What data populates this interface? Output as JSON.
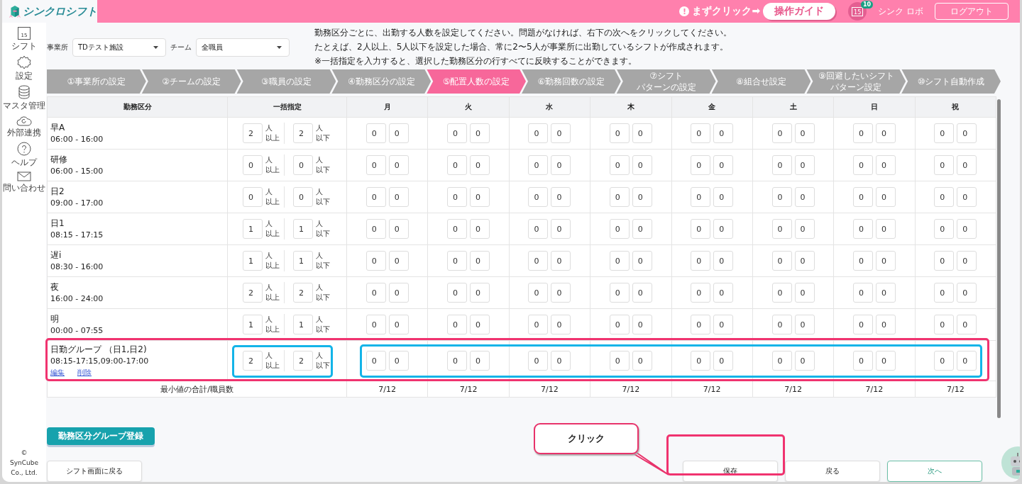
{
  "header": {
    "app_name": "シンクロシフト",
    "hint_icon": "!",
    "hint": "まずクリック➡",
    "guide_button": "操作ガイド",
    "calendar_day": "15",
    "notification_count": "10",
    "user": "シンク ロボ",
    "logout": "ログアウト"
  },
  "sidebar": {
    "items": [
      {
        "label": "シフト",
        "icon_text": "15"
      },
      {
        "label": "設定"
      },
      {
        "label": "マスタ管理"
      },
      {
        "label": "外部連携"
      },
      {
        "label": "ヘルプ"
      },
      {
        "label": "問い合わせ"
      }
    ],
    "copyright": "© SynCube Co., Ltd."
  },
  "filters": [
    {
      "label": "事業所",
      "value": "TDテスト施設"
    },
    {
      "label": "チーム",
      "value": "全職員"
    }
  ],
  "instructions": [
    "勤務区分ごとに、出勤する人数を設定してください。問題がなければ、右下の次へをクリックしてください。",
    "たとえば、2人以上、5人以下を設定した場合、常に2〜5人が事業所に出勤しているシフトが作成されます。",
    "※一括指定を入力すると、選択した勤務区分の行すべてに反映することができます。"
  ],
  "steps": [
    {
      "lines": [
        "①事業所の設定"
      ],
      "selected": false
    },
    {
      "lines": [
        "②チームの設定"
      ],
      "selected": false
    },
    {
      "lines": [
        "③職員の設定"
      ],
      "selected": false
    },
    {
      "lines": [
        "④勤務区分の設定"
      ],
      "selected": false
    },
    {
      "lines": [
        "⑤配置人数の設定"
      ],
      "selected": true
    },
    {
      "lines": [
        "⑥勤務回数の設定"
      ],
      "selected": false
    },
    {
      "lines": [
        "⑦シフト",
        "パターンの設定"
      ],
      "selected": false
    },
    {
      "lines": [
        "⑧組合せ設定"
      ],
      "selected": false
    },
    {
      "lines": [
        "⑨回避したいシフト",
        "パターン設定"
      ],
      "selected": false
    },
    {
      "lines": [
        "⑩シフト自動作成"
      ],
      "selected": false
    }
  ],
  "table": {
    "columns": [
      "勤務区分",
      "一括指定",
      "月",
      "火",
      "水",
      "木",
      "金",
      "土",
      "日",
      "祝"
    ],
    "rows": [
      {
        "kind": "shift",
        "name": "早A",
        "time": "06:00 - 16:00",
        "min": "2",
        "min_unit": [
          "人",
          "以上"
        ],
        "max": "2",
        "max_unit": [
          "人",
          "以下"
        ],
        "days": [
          [
            "0",
            "0"
          ],
          [
            "0",
            "0"
          ],
          [
            "0",
            "0"
          ],
          [
            "0",
            "0"
          ],
          [
            "0",
            "0"
          ],
          [
            "0",
            "0"
          ],
          [
            "0",
            "0"
          ],
          [
            "0",
            "0"
          ]
        ]
      },
      {
        "kind": "shift",
        "name": "研修",
        "time": "06:00 - 15:00",
        "min": "0",
        "min_unit": [
          "人",
          "以上"
        ],
        "max": "0",
        "max_unit": [
          "人",
          "以下"
        ],
        "days": [
          [
            "0",
            "0"
          ],
          [
            "0",
            "0"
          ],
          [
            "0",
            "0"
          ],
          [
            "0",
            "0"
          ],
          [
            "0",
            "0"
          ],
          [
            "0",
            "0"
          ],
          [
            "0",
            "0"
          ],
          [
            "0",
            "0"
          ]
        ]
      },
      {
        "kind": "shift",
        "name": "日2",
        "time": "09:00 - 17:00",
        "min": "0",
        "min_unit": [
          "人",
          "以上"
        ],
        "max": "0",
        "max_unit": [
          "人",
          "以下"
        ],
        "days": [
          [
            "0",
            "0"
          ],
          [
            "0",
            "0"
          ],
          [
            "0",
            "0"
          ],
          [
            "0",
            "0"
          ],
          [
            "0",
            "0"
          ],
          [
            "0",
            "0"
          ],
          [
            "0",
            "0"
          ],
          [
            "0",
            "0"
          ]
        ]
      },
      {
        "kind": "shift",
        "name": "日1",
        "time": "08:15 - 17:15",
        "min": "1",
        "min_unit": [
          "人",
          "以上"
        ],
        "max": "1",
        "max_unit": [
          "人",
          "以下"
        ],
        "days": [
          [
            "0",
            "0"
          ],
          [
            "0",
            "0"
          ],
          [
            "0",
            "0"
          ],
          [
            "0",
            "0"
          ],
          [
            "0",
            "0"
          ],
          [
            "0",
            "0"
          ],
          [
            "0",
            "0"
          ],
          [
            "0",
            "0"
          ]
        ]
      },
      {
        "kind": "shift",
        "name": "遅i",
        "time": "08:30 - 16:00",
        "min": "1",
        "min_unit": [
          "人",
          "以上"
        ],
        "max": "1",
        "max_unit": [
          "人",
          "以下"
        ],
        "days": [
          [
            "0",
            "0"
          ],
          [
            "0",
            "0"
          ],
          [
            "0",
            "0"
          ],
          [
            "0",
            "0"
          ],
          [
            "0",
            "0"
          ],
          [
            "0",
            "0"
          ],
          [
            "0",
            "0"
          ],
          [
            "0",
            "0"
          ]
        ]
      },
      {
        "kind": "shift",
        "name": "夜",
        "time": "16:00 - 24:00",
        "min": "2",
        "min_unit": [
          "人",
          "以上"
        ],
        "max": "2",
        "max_unit": [
          "人",
          "以下"
        ],
        "days": [
          [
            "0",
            "0"
          ],
          [
            "0",
            "0"
          ],
          [
            "0",
            "0"
          ],
          [
            "0",
            "0"
          ],
          [
            "0",
            "0"
          ],
          [
            "0",
            "0"
          ],
          [
            "0",
            "0"
          ],
          [
            "0",
            "0"
          ]
        ]
      },
      {
        "kind": "shift",
        "name": "明",
        "time": "00:00 - 07:55",
        "min": "1",
        "min_unit": [
          "人",
          "以上"
        ],
        "max": "1",
        "max_unit": [
          "人",
          "以下"
        ],
        "days": [
          [
            "0",
            "0"
          ],
          [
            "0",
            "0"
          ],
          [
            "0",
            "0"
          ],
          [
            "0",
            "0"
          ],
          [
            "0",
            "0"
          ],
          [
            "0",
            "0"
          ],
          [
            "0",
            "0"
          ],
          [
            "0",
            "0"
          ]
        ]
      },
      {
        "kind": "group",
        "name": "日勤グループ （日1,日2)",
        "time": "08:15-17:15,09:00-17:00",
        "links": [
          "編集",
          "削除"
        ],
        "min": "2",
        "min_unit": [
          "人",
          "以上"
        ],
        "max": "2",
        "max_unit": [
          "人",
          "以下"
        ],
        "days": [
          [
            "0",
            "0"
          ],
          [
            "0",
            "0"
          ],
          [
            "0",
            "0"
          ],
          [
            "0",
            "0"
          ],
          [
            "0",
            "0"
          ],
          [
            "0",
            "0"
          ],
          [
            "0",
            "0"
          ],
          [
            "0",
            "0"
          ]
        ]
      }
    ],
    "footer": {
      "label": "最小値の合計/職員数",
      "totals": [
        "7/12",
        "7/12",
        "7/12",
        "7/12",
        "7/12",
        "7/12",
        "7/12",
        "7/12"
      ]
    }
  },
  "group_button": "勤務区分グループ登録",
  "back_to_shift": "シフト画面に戻る",
  "actions": [
    {
      "label": "保存",
      "kind": "save"
    },
    {
      "label": "戻る",
      "kind": "back"
    },
    {
      "label": "次へ",
      "kind": "next"
    }
  ],
  "callout": "クリック"
}
